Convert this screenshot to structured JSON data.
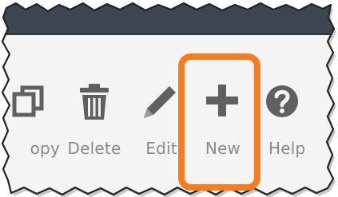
{
  "toolbar": {
    "items": [
      {
        "id": "copy",
        "label": "opy",
        "icon": "copy-icon"
      },
      {
        "id": "delete",
        "label": "Delete",
        "icon": "trash-icon"
      },
      {
        "id": "edit",
        "label": "Edit",
        "icon": "pencil-icon"
      },
      {
        "id": "new",
        "label": "New",
        "icon": "plus-icon"
      },
      {
        "id": "help",
        "label": "Help",
        "icon": "question-icon"
      }
    ]
  },
  "colors": {
    "header_bar": "#3c4650",
    "toolbar_background": "#f4f4f4",
    "icon_color": "#606060",
    "label_color": "#8a8a8a",
    "highlight": "#f57c1f"
  },
  "highlighted_item": "new"
}
